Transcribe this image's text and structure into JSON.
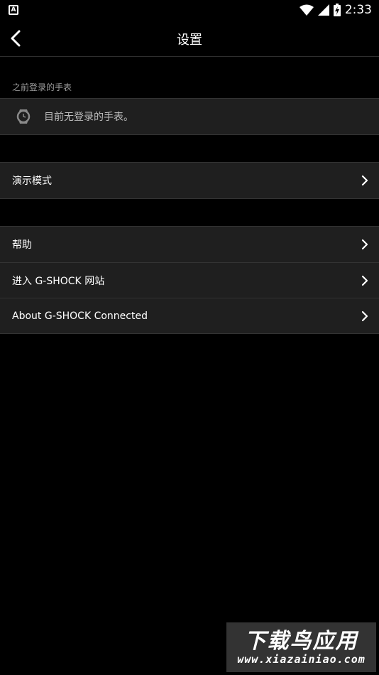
{
  "status_bar": {
    "notification_icon_letter": "A",
    "time": "2:33",
    "icons": [
      "wifi-icon",
      "signal-icon",
      "battery-charging-icon"
    ]
  },
  "app_bar": {
    "title": "设置",
    "back_icon": "back-arrow-icon"
  },
  "registered_watches": {
    "label": "之前登录的手表",
    "empty_text": "目前无登录的手表。",
    "icon": "watch-icon"
  },
  "demo_group": {
    "items": [
      {
        "label": "演示模式"
      }
    ]
  },
  "info_group": {
    "items": [
      {
        "label": "帮助"
      },
      {
        "label": "进入 G-SHOCK 网站"
      },
      {
        "label": "About G-SHOCK Connected"
      }
    ]
  },
  "watermark": {
    "title": "下载鸟应用",
    "url": "www.xiazainiao.com"
  },
  "colors": {
    "background": "#000000",
    "row_background": "#1f1f1f",
    "divider": "#333333",
    "secondary_text": "#9a9a9a"
  }
}
